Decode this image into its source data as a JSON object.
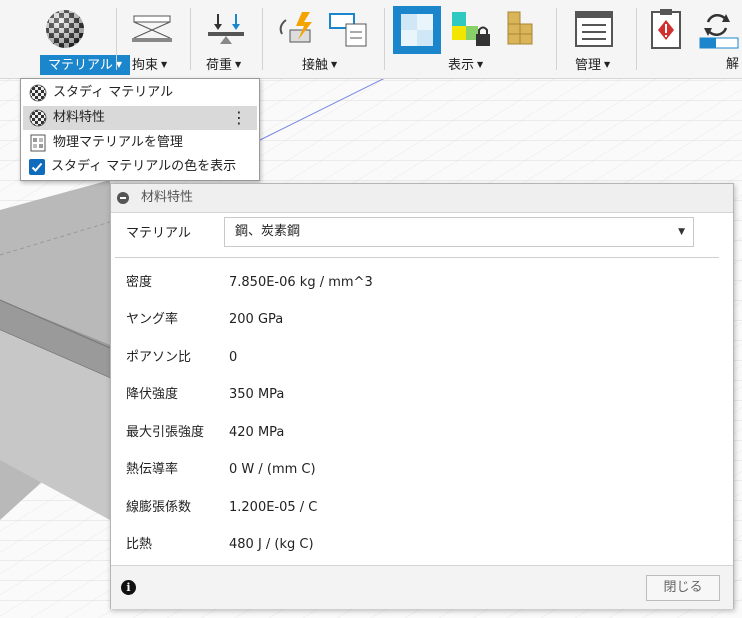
{
  "ribbon": {
    "groups": [
      {
        "label": "マテリアル",
        "icon": "material-sphere-icon",
        "active": true
      },
      {
        "label": "拘束",
        "icon": "constraint-icon"
      },
      {
        "label": "荷重",
        "icon": "load-icon"
      },
      {
        "label": "接触",
        "icon": "contact-icon"
      },
      {
        "label": "表示",
        "icon": "display-icon"
      },
      {
        "label": "管理",
        "icon": "manage-icon"
      },
      {
        "label": "解",
        "icon": "solve-icon"
      }
    ]
  },
  "material_menu": {
    "items": [
      {
        "label": "スタディ マテリアル",
        "icon": "checker-sphere-icon"
      },
      {
        "label": "材料特性",
        "icon": "checker-sphere-icon",
        "highlighted": true
      },
      {
        "label": "物理マテリアルを管理",
        "icon": "material-library-icon"
      },
      {
        "label": "スタディ マテリアルの色を表示",
        "icon": "checkbox-checked-icon",
        "checked": true
      }
    ]
  },
  "properties_panel": {
    "title": "材料特性",
    "material_label": "マテリアル",
    "material_value": "鋼、炭素鋼",
    "properties": [
      {
        "label": "密度",
        "value": "7.850E-06 kg / mm^3"
      },
      {
        "label": "ヤング率",
        "value": "200 GPa"
      },
      {
        "label": "ポアソン比",
        "value": "0"
      },
      {
        "label": "降伏強度",
        "value": "350 MPa"
      },
      {
        "label": "最大引張強度",
        "value": "420 MPa"
      },
      {
        "label": "熱伝導率",
        "value": "0 W / (mm C)"
      },
      {
        "label": "線膨張係数",
        "value": "1.200E-05 / C"
      },
      {
        "label": "比熱",
        "value": "480 J / (kg C)"
      }
    ],
    "close_label": "閉じる"
  },
  "colors": {
    "accent": "#1c86cc",
    "menu_highlight": "#d9d9d9",
    "panel_header": "#efefef"
  }
}
